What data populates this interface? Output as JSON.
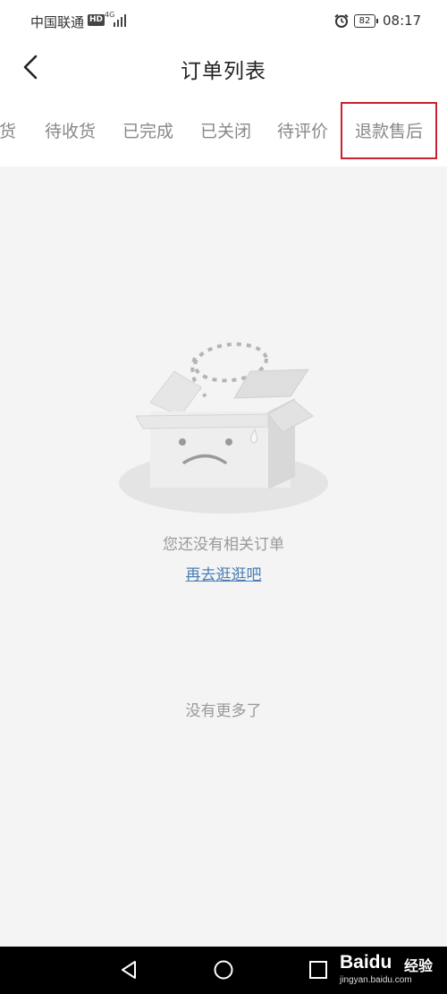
{
  "status_bar": {
    "carrier": "中国联通",
    "hd": "HD",
    "network": "4G",
    "battery": "82",
    "time": "08:17"
  },
  "header": {
    "title": "订单列表",
    "back_icon": "chevron-left-icon"
  },
  "tabs": [
    {
      "label": "发货",
      "partial": true
    },
    {
      "label": "待收货"
    },
    {
      "label": "已完成"
    },
    {
      "label": "已关闭"
    },
    {
      "label": "待评价"
    },
    {
      "label": "退款售后",
      "highlighted": true
    }
  ],
  "highlight_color": "#c8212f",
  "empty_state": {
    "illustration": "empty-box-sad-face",
    "message": "您还没有相关订单",
    "link": "再去逛逛吧"
  },
  "footer_text": "没有更多了",
  "nav_bar": {
    "back_icon": "triangle-back-icon",
    "home_icon": "circle-home-icon",
    "recents_icon": "square-recents-icon"
  },
  "watermark": {
    "brand": "Baidu",
    "label": "经验",
    "url": "jingyan.baidu.com"
  }
}
